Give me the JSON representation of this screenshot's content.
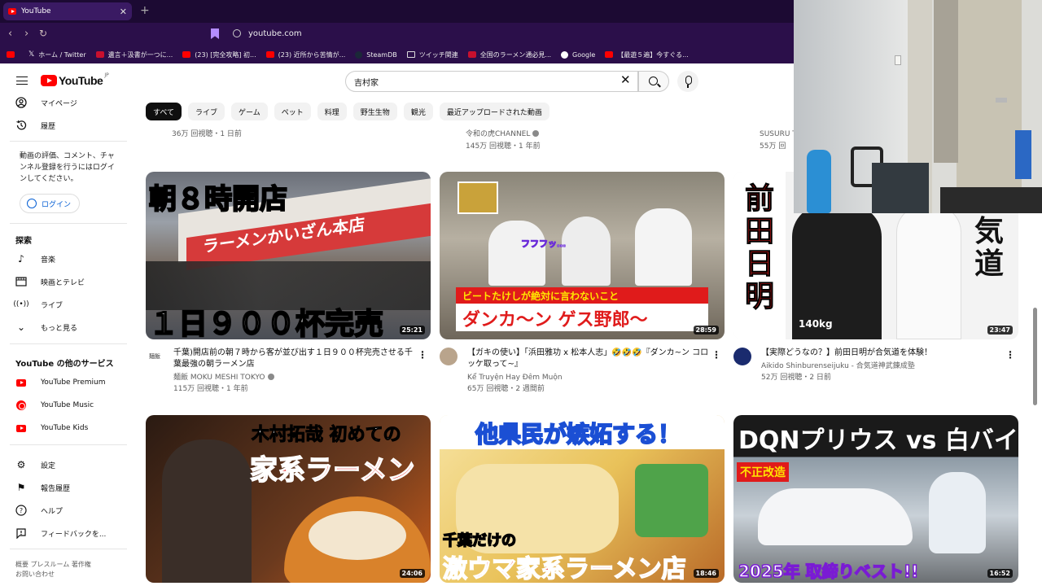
{
  "browser": {
    "tab_title": "YouTube",
    "url": "youtube.com",
    "bookmarks": [
      {
        "label": "ホーム / Twitter",
        "icon": "x-icon"
      },
      {
        "label": "遺言＋汲書が一つに...",
        "icon": "bookmark-red-icon"
      },
      {
        "label": "(23) [完全攻略] 初...",
        "icon": "youtube-icon"
      },
      {
        "label": "(23) 近所から苦情が...",
        "icon": "youtube-icon"
      },
      {
        "label": "SteamDB",
        "icon": "steam-icon"
      },
      {
        "label": "ツイッチ関連",
        "icon": "folder-icon"
      },
      {
        "label": "全国のラーメン通必見...",
        "icon": "ramen-site-icon"
      },
      {
        "label": "Google",
        "icon": "google-icon"
      },
      {
        "label": "【最遊５遍】今すぐる...",
        "icon": "youtube-icon"
      }
    ]
  },
  "youtube": {
    "logo_text": "YouTube",
    "logo_region": "JP",
    "search_query": "吉村家"
  },
  "sidebar": {
    "top_items": [
      {
        "label": "マイページ",
        "icon": "account-icon"
      },
      {
        "label": "履歴",
        "icon": "history-icon"
      }
    ],
    "signin_note": "動画の評価、コメント、チャンネル登録を行うにはログインしてください。",
    "login_label": "ログイン",
    "explore_heading": "探索",
    "explore_items": [
      {
        "label": "音楽",
        "icon": "music-icon"
      },
      {
        "label": "映画とテレビ",
        "icon": "film-icon"
      },
      {
        "label": "ライブ",
        "icon": "live-icon"
      },
      {
        "label": "もっと見る",
        "icon": "chevron-down-icon"
      }
    ],
    "more_heading": "YouTube の他のサービス",
    "more_items": [
      {
        "label": "YouTube Premium",
        "icon": "youtube-premium-icon"
      },
      {
        "label": "YouTube Music",
        "icon": "youtube-music-icon"
      },
      {
        "label": "YouTube Kids",
        "icon": "youtube-kids-icon"
      }
    ],
    "settings_items": [
      {
        "label": "設定",
        "icon": "gear-icon"
      },
      {
        "label": "報告履歴",
        "icon": "flag-icon"
      },
      {
        "label": "ヘルプ",
        "icon": "help-icon"
      },
      {
        "label": "フィードバックを...",
        "icon": "feedback-icon"
      }
    ],
    "footer_line1": "概要  プレスルーム  著作権",
    "footer_line2": "お問い合わせ"
  },
  "chips": [
    "すべて",
    "ライブ",
    "ゲーム",
    "ペット",
    "料理",
    "野生生物",
    "観光",
    "最近アップロードされた動画"
  ],
  "partial_row": [
    {
      "stats": "36万 回視聴・1 日前"
    },
    {
      "channel": "令和の虎CHANNEL",
      "stats": "145万 回視聴・1 年前"
    },
    {
      "channel": "SUSURU T",
      "stats": "55万 回"
    }
  ],
  "videos": [
    {
      "title": "千葉)開店前の朝７時から客が並び出す１日９００杯完売させる千葉最強の朝ラーメン店",
      "channel": "麺飯 MOKU MESHI TOKYO",
      "verified": true,
      "stats": "115万 回視聴・1 年前",
      "duration": "25:21",
      "thumb_top": "朝８時開店",
      "thumb_mid": "ラーメンかいざん本店",
      "thumb_bottom": "１日９００杯完売",
      "avatar_label": "麺飯"
    },
    {
      "title": "【ガキの使い】「浜田雅功 x 松本人志」🤣🤣🤣『ダンカ~ン コロッケ取って~』",
      "channel": "Kể Truyện Hay Đêm Muộn",
      "verified": false,
      "stats": "65万 回視聴・2 週間前",
      "duration": "28:59",
      "thumb_top": "ビートたけしが絶対に言わないこと",
      "thumb_mid": "フフフッ…",
      "thumb_bottom": "ダンカ～ン ゲス野郎～"
    },
    {
      "title": "【実際どうなの？】前田日明が合気道を体験！",
      "channel": "Aikido Shinburenseijuku - 合気道神武錬成塾",
      "verified": false,
      "stats": "52万 回視聴・2 日前",
      "duration": "23:47",
      "thumb_left": "前田日明",
      "thumb_right": "合気道",
      "thumb_small": "140kg"
    },
    {
      "duration": "24:06",
      "thumb_top": "木村拓哉 初めての",
      "thumb_mid": "家系ラーメン"
    },
    {
      "duration": "18:46",
      "thumb_top": "他県民が嫉妬する！",
      "thumb_mid": "千葉だけの",
      "thumb_bottom": "激ウマ家系ラーメン店"
    },
    {
      "duration": "16:52",
      "thumb_top": "DQNプリウス vs 白バイ",
      "thumb_mid": "不正改造",
      "thumb_bottom": "2025年 取締りベスト!!"
    }
  ],
  "colors": {
    "youtube_red": "#ff0000",
    "chrome_bg": "#2b0f4a",
    "link_blue": "#065fd4"
  }
}
